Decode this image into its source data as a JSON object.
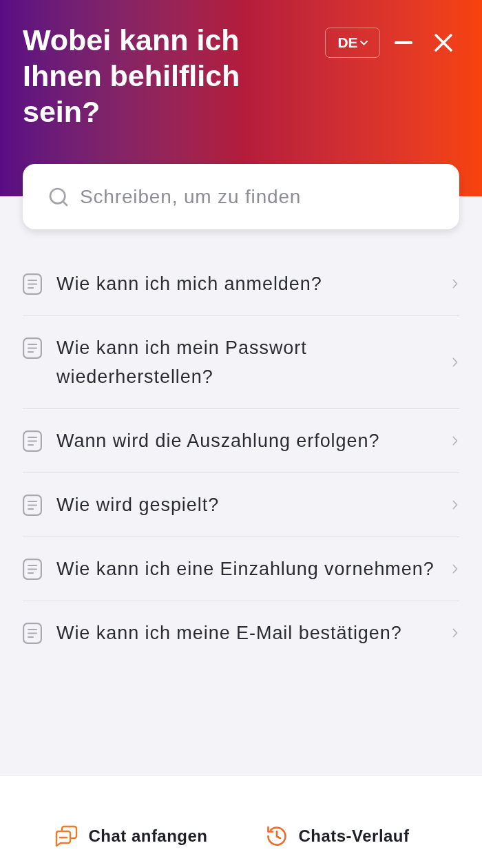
{
  "header": {
    "title": "Wobei kann ich Ihnen behilflich sein?",
    "language": "DE"
  },
  "search": {
    "placeholder": "Schreiben, um zu finden"
  },
  "articles": [
    {
      "title": "Wie kann ich mich anmelden?"
    },
    {
      "title": "Wie kann ich mein Passwort wiederherstellen?"
    },
    {
      "title": "Wann wird die Auszahlung erfolgen?"
    },
    {
      "title": "Wie wird gespielt?"
    },
    {
      "title": "Wie kann ich eine Einzahlung vornehmen?"
    },
    {
      "title": "Wie kann ich meine E-Mail bestätigen?"
    }
  ],
  "footer": {
    "buttons": [
      {
        "kind": "start-chat",
        "label": "Chat anfangen"
      },
      {
        "kind": "history",
        "label": "Chats-Verlauf"
      }
    ]
  }
}
